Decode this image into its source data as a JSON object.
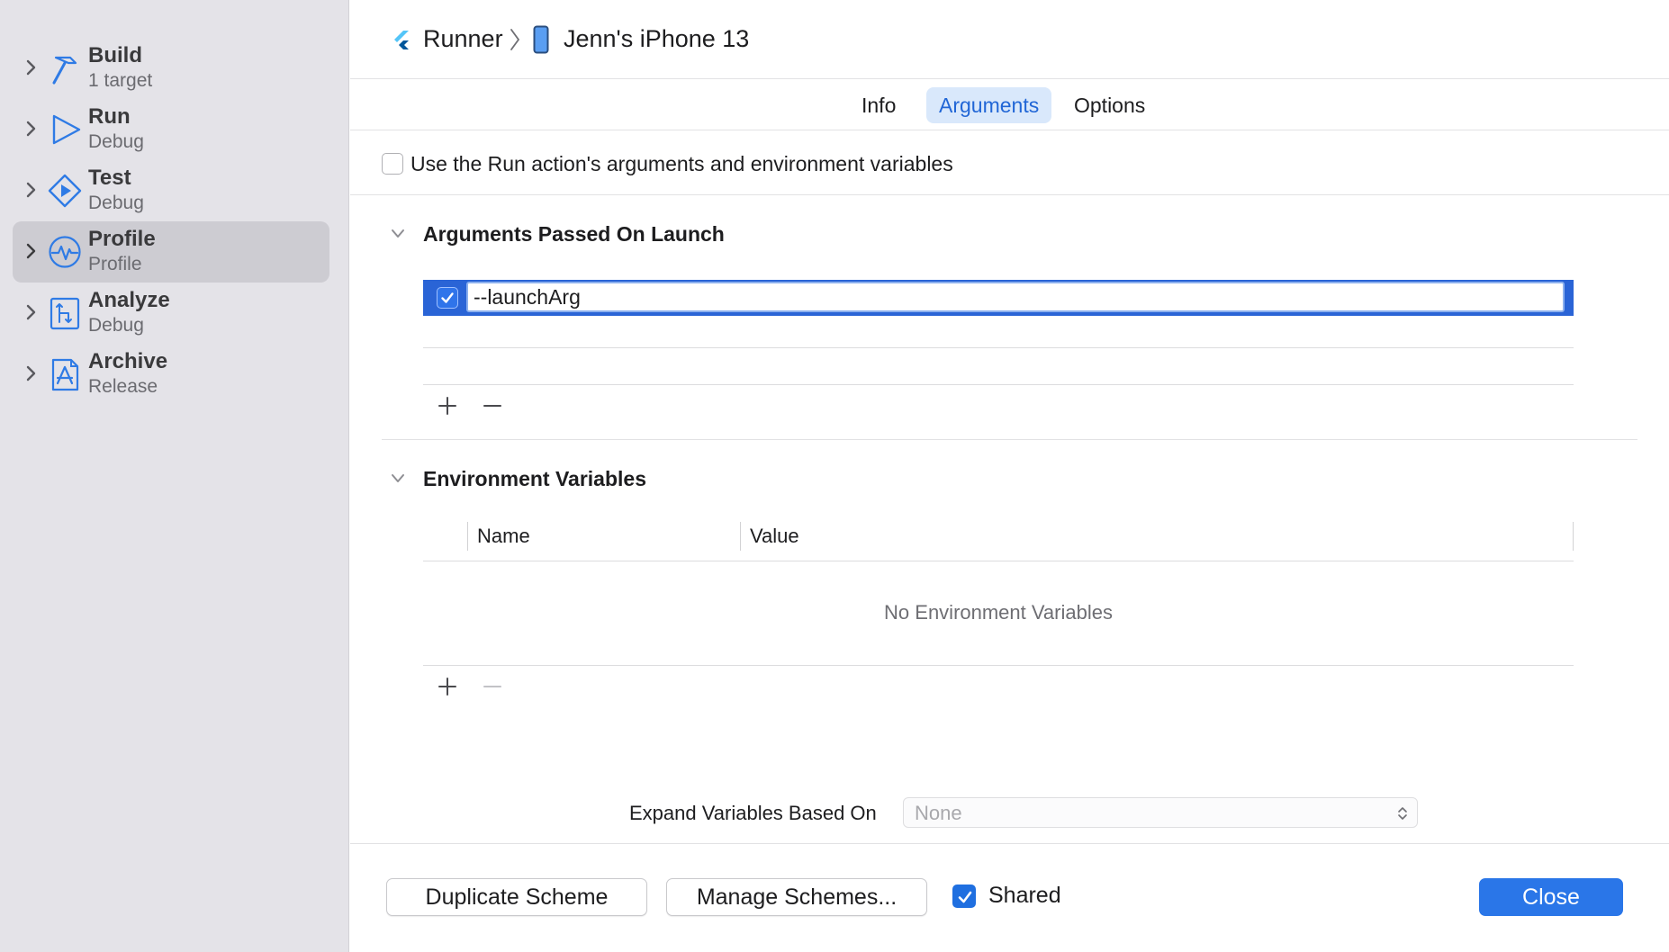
{
  "sidebar": {
    "actions": [
      {
        "name": "Build",
        "config": "1 target",
        "icon": "hammer-icon"
      },
      {
        "name": "Run",
        "config": "Debug",
        "icon": "play-icon"
      },
      {
        "name": "Test",
        "config": "Debug",
        "icon": "test-diamond-icon"
      },
      {
        "name": "Profile",
        "config": "Profile",
        "icon": "waveform-icon",
        "selected": true
      },
      {
        "name": "Analyze",
        "config": "Debug",
        "icon": "analyze-icon"
      },
      {
        "name": "Archive",
        "config": "Release",
        "icon": "app-store-icon"
      }
    ]
  },
  "breadcrumb": {
    "project": "Runner",
    "device": "Jenn's iPhone 13"
  },
  "tabs": {
    "info": "Info",
    "arguments": "Arguments",
    "options": "Options",
    "selected": "Arguments"
  },
  "use_run_action": {
    "label": "Use the Run action's arguments and environment variables",
    "checked": false
  },
  "arguments_section": {
    "title": "Arguments Passed On Launch",
    "items": [
      {
        "value": "--launchArg",
        "enabled": true
      }
    ]
  },
  "env_section": {
    "title": "Environment Variables",
    "columns": {
      "name": "Name",
      "value": "Value"
    },
    "empty_text": "No Environment Variables"
  },
  "expand_variables": {
    "label": "Expand Variables Based On",
    "value": "None"
  },
  "footer": {
    "duplicate_label": "Duplicate Scheme",
    "manage_label": "Manage Schemes...",
    "shared_label": "Shared",
    "shared_checked": true,
    "close_label": "Close"
  },
  "colors": {
    "accent": "#2a76e8",
    "sidebar_bg": "#e4e3e8",
    "selected_row": "#cdccd2",
    "tab_selected_bg": "#d9e8fb"
  }
}
